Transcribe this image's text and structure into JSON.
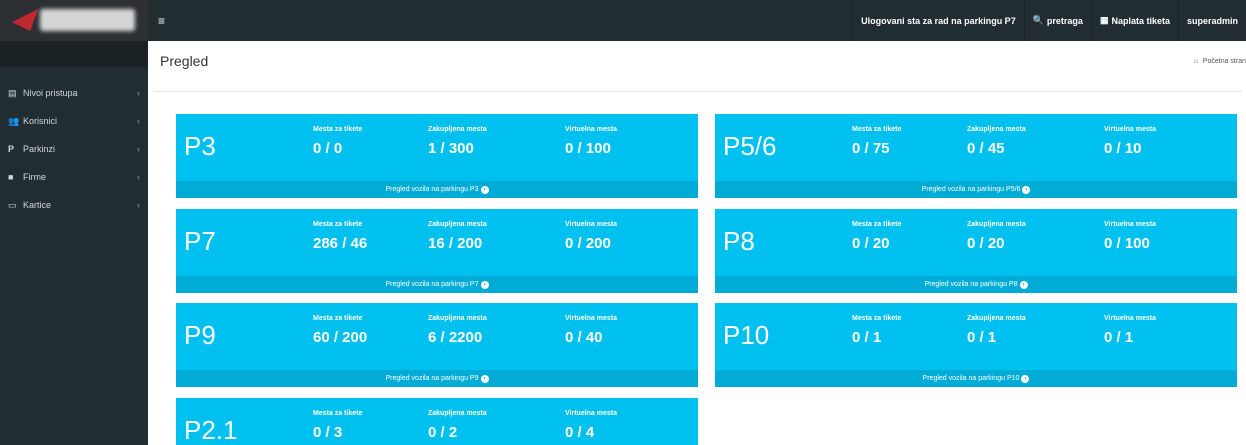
{
  "sidebar": {
    "items": [
      {
        "label": "Nivoi pristupa",
        "icon": "id-card-icon",
        "glyph": "▤"
      },
      {
        "label": "Korisnici",
        "icon": "users-icon",
        "glyph": "👥"
      },
      {
        "label": "Parkinzi",
        "icon": "parking-icon",
        "glyph": "P"
      },
      {
        "label": "Firme",
        "icon": "briefcase-icon",
        "glyph": "■"
      },
      {
        "label": "Kartice",
        "icon": "credit-card-icon",
        "glyph": "▭"
      }
    ],
    "chevron": "‹"
  },
  "topbar": {
    "menu_glyph": "≡",
    "status": "Ulogovani sta za rad na parkingu P7",
    "search": "pretraga",
    "search_glyph": "🔍",
    "ticket_payment": "Naplata tiketa",
    "ticket_glyph": "▦",
    "user": "superadmin"
  },
  "page": {
    "title": "Pregled",
    "breadcrumb": "Početna stran",
    "home_glyph": "⌂"
  },
  "labels": {
    "ticket_spots": "Mesta za tikete",
    "rented_spots": "Zakupljena mesta",
    "virtual_spots": "Virtuelna mesta",
    "arrow_glyph": "›"
  },
  "parkings": [
    {
      "name": "P3",
      "tickets": "0 / 0",
      "rented": "1 / 300",
      "virtual": "0 / 100",
      "link": "Pregled vozila na parkingu P3"
    },
    {
      "name": "P5/6",
      "tickets": "0 / 75",
      "rented": "0 / 45",
      "virtual": "0 / 10",
      "link": "Pregled vozila na parkingu P5/6"
    },
    {
      "name": "P7",
      "tickets": "286 / 46",
      "rented": "16 / 200",
      "virtual": "0 / 200",
      "link": "Pregled vozila na parkingu P7"
    },
    {
      "name": "P8",
      "tickets": "0 / 20",
      "rented": "0 / 20",
      "virtual": "0 / 100",
      "link": "Pregled vozila na parkingu P8"
    },
    {
      "name": "P9",
      "tickets": "60 / 200",
      "rented": "6 / 2200",
      "virtual": "0 / 40",
      "link": "Pregled vozila na parkingu P9"
    },
    {
      "name": "P10",
      "tickets": "0 / 1",
      "rented": "0 / 1",
      "virtual": "0 / 1",
      "link": "Pregled vozila na parkingu P10"
    },
    {
      "name": "P2.1",
      "tickets": "0 / 3",
      "rented": "0 / 2",
      "virtual": "0 / 4",
      "link": ""
    }
  ],
  "colors": {
    "box": "#00c0ef",
    "box_footer": "#00acd6",
    "sidebar": "#222d32"
  }
}
